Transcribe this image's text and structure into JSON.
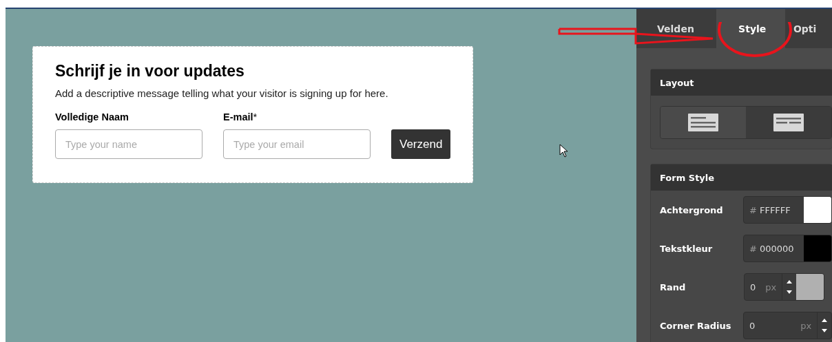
{
  "form": {
    "title": "Schrijf je in voor updates",
    "description": "Add a descriptive message telling what your visitor is signing up for here.",
    "fields": [
      {
        "label": "Volledige Naam",
        "placeholder": "Type your name"
      },
      {
        "label": "E-mail",
        "required_mark": "*",
        "placeholder": "Type your email"
      }
    ],
    "submit": "Verzend"
  },
  "tabs": [
    {
      "label": "Velden",
      "selected": false
    },
    {
      "label": "Style",
      "selected": true
    },
    {
      "label": "Opti",
      "selected": false
    }
  ],
  "layout": {
    "title": "Layout",
    "options": [
      {
        "kind": "stacked",
        "selected": true
      },
      {
        "kind": "inline",
        "selected": false
      }
    ]
  },
  "form_style": {
    "title": "Form Style",
    "rows": [
      {
        "kind": "color",
        "label": "Achtergrond",
        "prefix": "#",
        "value": "FFFFFF",
        "color": "#ffffff"
      },
      {
        "kind": "color",
        "label": "Tekstkleur",
        "prefix": "#",
        "value": "000000",
        "color": "#000000"
      },
      {
        "kind": "number-color",
        "label": "Rand",
        "value": "0",
        "unit": "px",
        "color": "#b0b0b0"
      },
      {
        "kind": "number",
        "label": "Corner Radius",
        "value": "0",
        "unit": "px"
      }
    ]
  }
}
